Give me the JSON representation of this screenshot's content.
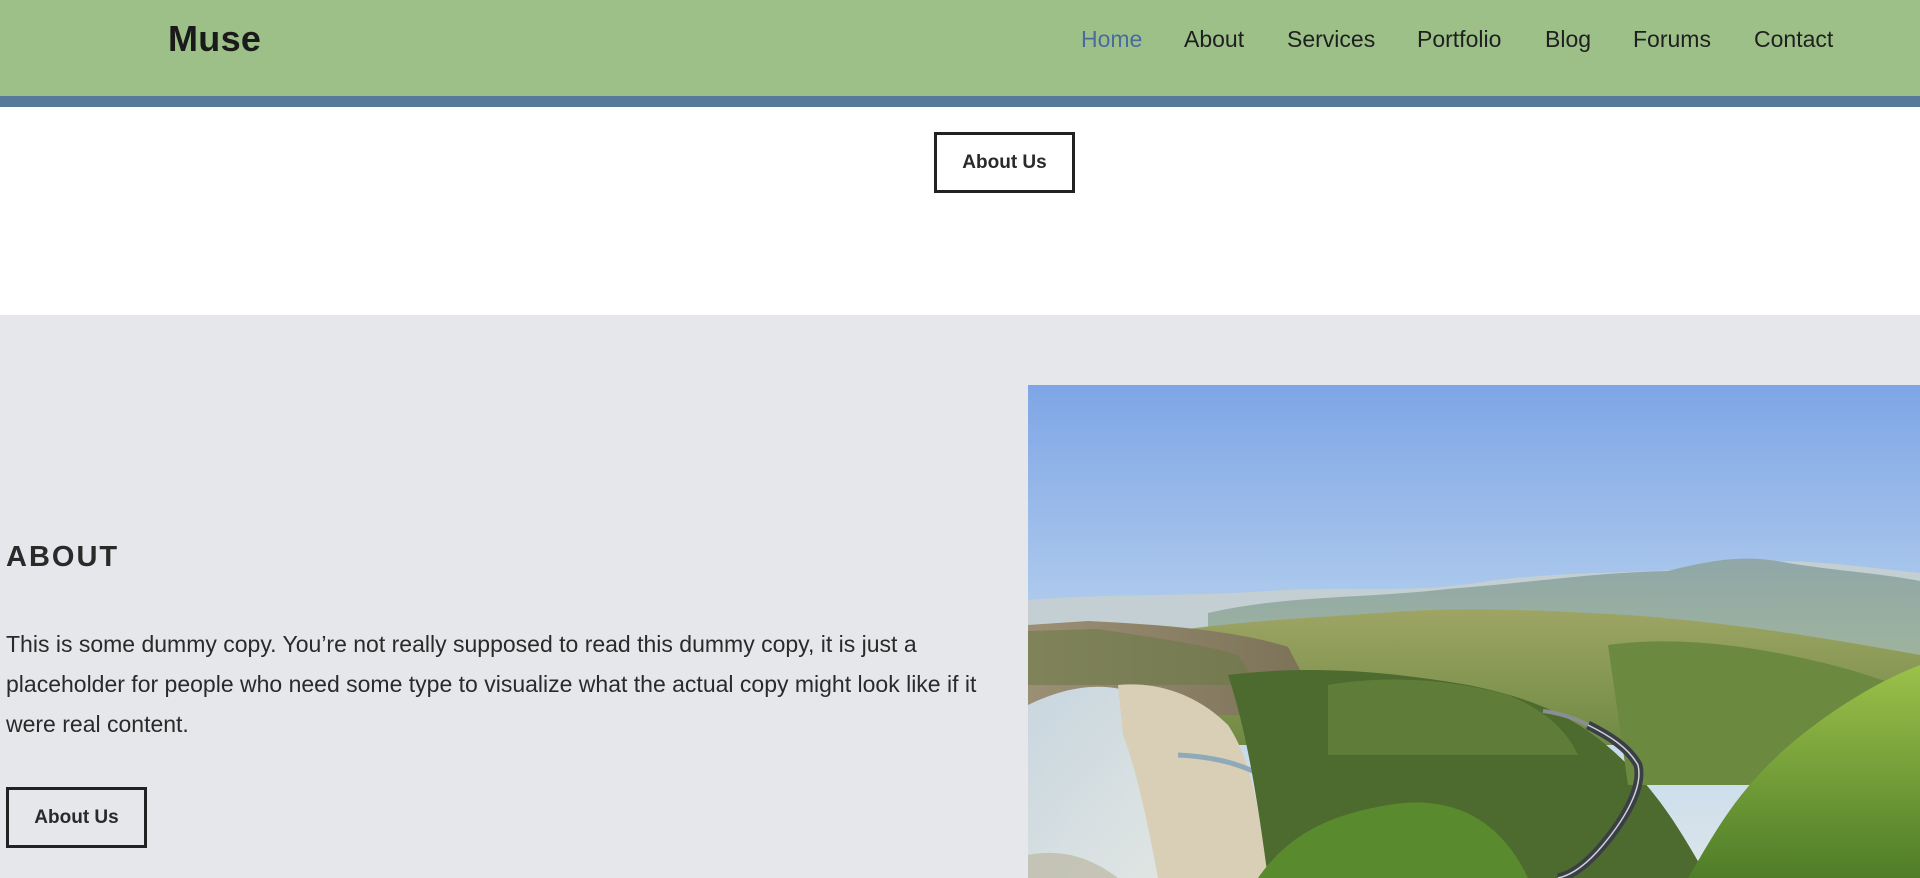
{
  "header": {
    "logo": "Muse",
    "nav": [
      {
        "label": "Home",
        "active": true
      },
      {
        "label": "About",
        "active": false
      },
      {
        "label": "Services",
        "active": false
      },
      {
        "label": "Portfolio",
        "active": false
      },
      {
        "label": "Blog",
        "active": false
      },
      {
        "label": "Forums",
        "active": false
      },
      {
        "label": "Contact",
        "active": false
      }
    ]
  },
  "hero": {
    "button_label": "About Us"
  },
  "about": {
    "heading": "ABOUT",
    "body": "This is some dummy copy. You’re not really supposed to read this dummy copy, it is just a placeholder for people who need some type to visualize what the actual copy might look like if it were real content.",
    "button_label": "About Us"
  },
  "colors": {
    "header_bg": "#9cc087",
    "header_bar": "#57799a",
    "nav_active": "#4a6aa0",
    "about_bg": "#e6e7ea"
  }
}
